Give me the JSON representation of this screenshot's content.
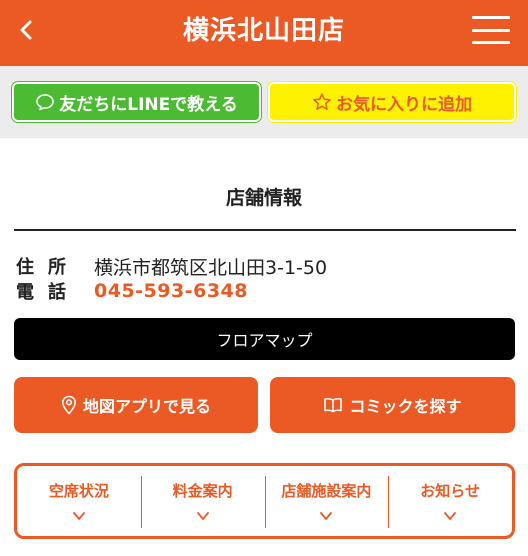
{
  "header": {
    "title": "横浜北山田店",
    "back_icon": "chevron-left-icon",
    "menu_icon": "hamburger-menu-icon"
  },
  "actions": {
    "line_label": "友だちにLINEで教える",
    "favorite_label": "お気に入りに追加"
  },
  "store_info": {
    "section_title": "店舗情報",
    "address_label": "住所",
    "address_value": "横浜市都筑区北山田3-1-50",
    "phone_label": "電話",
    "phone_value": "045-593-6348"
  },
  "buttons": {
    "floor_map": "フロアマップ",
    "map_app": "地図アプリで見る",
    "comic_search": "コミックを探す"
  },
  "tabs": [
    {
      "label": "空席状況"
    },
    {
      "label": "料金案内"
    },
    {
      "label": "店舗施設案内"
    },
    {
      "label": "お知らせ"
    }
  ],
  "colors": {
    "brand_orange": "#eb5a24",
    "line_green": "#4dba33",
    "favorite_yellow": "#fff200",
    "floor_map_black": "#000000"
  }
}
